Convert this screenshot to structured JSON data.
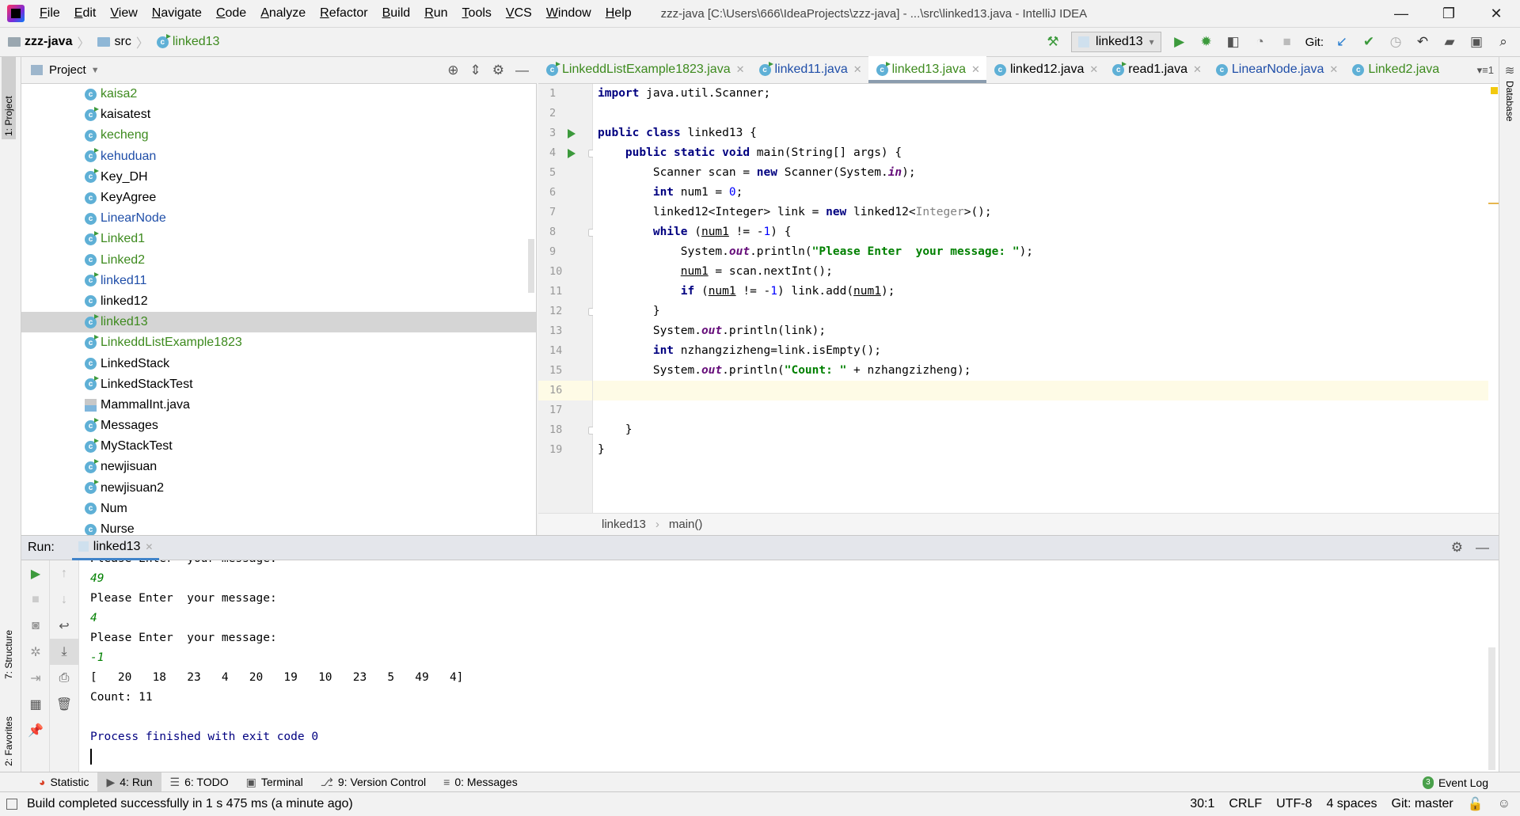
{
  "window": {
    "title": "zzz-java [C:\\Users\\666\\IdeaProjects\\zzz-java] - ...\\src\\linked13.java - IntelliJ IDEA",
    "menu": [
      "File",
      "Edit",
      "View",
      "Navigate",
      "Code",
      "Analyze",
      "Refactor",
      "Build",
      "Run",
      "Tools",
      "VCS",
      "Window",
      "Help"
    ],
    "controls": {
      "minimize": "—",
      "restore": "❐",
      "close": "✕"
    }
  },
  "navbar": {
    "crumbs": [
      "zzz-java",
      "src",
      "linked13"
    ],
    "run_config": "linked13",
    "git_label": "Git:"
  },
  "project": {
    "title": "Project",
    "stripe_label": "1: Project",
    "items": [
      {
        "label": "kaisa2",
        "color": "#3d8a1e",
        "runnable": false
      },
      {
        "label": "kaisatest",
        "color": "#000000",
        "runnable": true
      },
      {
        "label": "kecheng",
        "color": "#3d8a1e",
        "runnable": false
      },
      {
        "label": "kehuduan",
        "color": "#1f4ea8",
        "runnable": true
      },
      {
        "label": "Key_DH",
        "color": "#000000",
        "runnable": true
      },
      {
        "label": "KeyAgree",
        "color": "#000000",
        "runnable": false
      },
      {
        "label": "LinearNode",
        "color": "#1f4ea8",
        "runnable": false
      },
      {
        "label": "Linked1",
        "color": "#3d8a1e",
        "runnable": true
      },
      {
        "label": "Linked2",
        "color": "#3d8a1e",
        "runnable": false
      },
      {
        "label": "linked11",
        "color": "#1f4ea8",
        "runnable": true
      },
      {
        "label": "linked12",
        "color": "#000000",
        "runnable": false
      },
      {
        "label": "linked13",
        "color": "#3d8a1e",
        "runnable": true,
        "selected": true
      },
      {
        "label": "LinkeddListExample1823",
        "color": "#3d8a1e",
        "runnable": true
      },
      {
        "label": "LinkedStack",
        "color": "#000000",
        "runnable": false
      },
      {
        "label": "LinkedStackTest",
        "color": "#000000",
        "runnable": true
      },
      {
        "label": "MammalInt.java",
        "color": "#000000",
        "file": true
      },
      {
        "label": "Messages",
        "color": "#000000",
        "runnable": true
      },
      {
        "label": "MyStackTest",
        "color": "#000000",
        "runnable": true
      },
      {
        "label": "newjisuan",
        "color": "#000000",
        "runnable": true
      },
      {
        "label": "newjisuan2",
        "color": "#000000",
        "runnable": true
      },
      {
        "label": "Num",
        "color": "#000000",
        "runnable": false
      },
      {
        "label": "Nurse",
        "color": "#000000",
        "runnable": false
      }
    ]
  },
  "tabs": [
    {
      "label": "LinkeddListExample1823.java",
      "color": "#3d8a1e",
      "runnable": true
    },
    {
      "label": "linked11.java",
      "color": "#1f4ea8",
      "runnable": true
    },
    {
      "label": "linked13.java",
      "color": "#3d8a1e",
      "runnable": true,
      "active": true
    },
    {
      "label": "linked12.java",
      "color": "#000000",
      "runnable": false
    },
    {
      "label": "read1.java",
      "color": "#000000",
      "runnable": true
    },
    {
      "label": "LinearNode.java",
      "color": "#1f4ea8",
      "runnable": false
    },
    {
      "label": "Linked2.java",
      "color": "#3d8a1e",
      "runnable": false,
      "noclose": true
    }
  ],
  "tabs_more": "▾≡1",
  "editor": {
    "current_line": 16,
    "run_lines": [
      3,
      4
    ],
    "fold_lines": [
      4,
      8,
      12,
      18
    ],
    "lines": [
      [
        [
          "import",
          "kw"
        ],
        [
          " java.util.Scanner;",
          ""
        ]
      ],
      [],
      [
        [
          "public class",
          "kw"
        ],
        [
          " linked13 {",
          ""
        ]
      ],
      [
        [
          "    ",
          ""
        ],
        [
          "public static void",
          "kw"
        ],
        [
          " main(String[] args) {",
          ""
        ]
      ],
      [
        [
          "        Scanner scan = ",
          ""
        ],
        [
          "new",
          "kw"
        ],
        [
          " Scanner(System.",
          ""
        ],
        [
          "in",
          "st"
        ],
        [
          ");",
          ""
        ]
      ],
      [
        [
          "        ",
          ""
        ],
        [
          "int",
          "kw"
        ],
        [
          " num1 = ",
          ""
        ],
        [
          "0",
          "num"
        ],
        [
          ";",
          ""
        ]
      ],
      [
        [
          "        linked12<Integer> link = ",
          ""
        ],
        [
          "new",
          "kw"
        ],
        [
          " linked12<",
          ""
        ],
        [
          "Integer",
          "gen"
        ],
        [
          ">();",
          ""
        ]
      ],
      [
        [
          "        ",
          ""
        ],
        [
          "while",
          "kw"
        ],
        [
          " (",
          ""
        ],
        [
          "num1",
          "ul"
        ],
        [
          " != -",
          ""
        ],
        [
          "1",
          "num"
        ],
        [
          ") {",
          ""
        ]
      ],
      [
        [
          "            System.",
          ""
        ],
        [
          "out",
          "st"
        ],
        [
          ".println(",
          ""
        ],
        [
          "\"Please Enter  your message: \"",
          "str"
        ],
        [
          ");",
          ""
        ]
      ],
      [
        [
          "            ",
          ""
        ],
        [
          "num1",
          "ul"
        ],
        [
          " = scan.nextInt();",
          ""
        ]
      ],
      [
        [
          "            ",
          ""
        ],
        [
          "if",
          "kw"
        ],
        [
          " (",
          ""
        ],
        [
          "num1",
          "ul"
        ],
        [
          " != -",
          ""
        ],
        [
          "1",
          "num"
        ],
        [
          ") link.add(",
          ""
        ],
        [
          "num1",
          "ul"
        ],
        [
          ");",
          ""
        ]
      ],
      [
        [
          "        }",
          ""
        ]
      ],
      [
        [
          "        System.",
          ""
        ],
        [
          "out",
          "st"
        ],
        [
          ".println(link);",
          ""
        ]
      ],
      [
        [
          "        ",
          ""
        ],
        [
          "int",
          "kw"
        ],
        [
          " nzhangzizheng=link.isEmpty();",
          ""
        ]
      ],
      [
        [
          "        System.",
          ""
        ],
        [
          "out",
          "st"
        ],
        [
          ".println(",
          ""
        ],
        [
          "\"Count: \"",
          "str"
        ],
        [
          " + nzhangzizheng);",
          ""
        ]
      ],
      [],
      [],
      [
        [
          "    }",
          ""
        ]
      ],
      [
        [
          "}",
          ""
        ]
      ]
    ],
    "breadcrumb": [
      "linked13",
      "main()"
    ]
  },
  "run": {
    "label": "Run:",
    "tab": "linked13",
    "output": [
      {
        "text": "Please Enter  your message:",
        "type": "partial"
      },
      {
        "text": "49",
        "type": "input"
      },
      {
        "text": "Please Enter  your message:",
        "type": "out"
      },
      {
        "text": "4",
        "type": "input"
      },
      {
        "text": "Please Enter  your message:",
        "type": "out"
      },
      {
        "text": "-1",
        "type": "input"
      },
      {
        "text": "[   20   18   23   4   20   19   10   23   5   49   4]",
        "type": "out"
      },
      {
        "text": "Count: 11",
        "type": "out"
      },
      {
        "text": "",
        "type": "out"
      },
      {
        "text": "Process finished with exit code 0",
        "type": "sys"
      }
    ]
  },
  "side_tabs": {
    "structure": "7: Structure",
    "favorites": "2: Favorites",
    "database": "Database"
  },
  "bottom_tabs": [
    {
      "label": "Statistic",
      "icon": "statistic-icon"
    },
    {
      "label": "4: Run",
      "icon": "run-icon",
      "active": true
    },
    {
      "label": "6: TODO",
      "icon": "todo-icon"
    },
    {
      "label": "Terminal",
      "icon": "terminal-icon"
    },
    {
      "label": "9: Version Control",
      "icon": "version-control-icon"
    },
    {
      "label": "0: Messages",
      "icon": "messages-icon"
    }
  ],
  "event_log": {
    "label": "Event Log",
    "count": "3"
  },
  "status": {
    "message": "Build completed successfully in 1 s 475 ms (a minute ago)",
    "position": "30:1",
    "line_sep": "CRLF",
    "encoding": "UTF-8",
    "indent": "4 spaces",
    "git": "Git: master"
  }
}
